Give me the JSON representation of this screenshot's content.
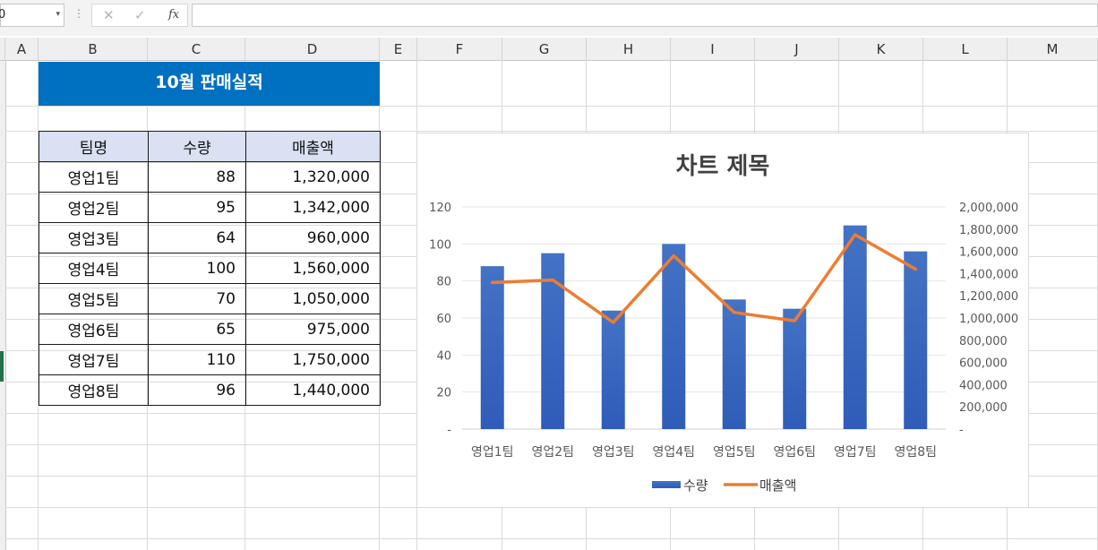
{
  "formula_bar": {
    "name_box_value": "0",
    "name_box_arrow": "▾",
    "dots": "⋮",
    "cancel_icon": "✕",
    "enter_icon": "✓",
    "fx_label": "fx",
    "formula_value": ""
  },
  "columns": [
    "A",
    "B",
    "C",
    "D",
    "E",
    "F",
    "G",
    "H",
    "I",
    "J",
    "K",
    "L",
    "M"
  ],
  "sheet": {
    "banner_title": "10월 판매실적",
    "table": {
      "headers": [
        "팀명",
        "수량",
        "매출액"
      ],
      "rows": [
        [
          "영업1팀",
          "88",
          "1,320,000"
        ],
        [
          "영업2팀",
          "95",
          "1,342,000"
        ],
        [
          "영업3팀",
          "64",
          "960,000"
        ],
        [
          "영업4팀",
          "100",
          "1,560,000"
        ],
        [
          "영업5팀",
          "70",
          "1,050,000"
        ],
        [
          "영업6팀",
          "65",
          "975,000"
        ],
        [
          "영업7팀",
          "110",
          "1,750,000"
        ],
        [
          "영업8팀",
          "96",
          "1,440,000"
        ]
      ]
    }
  },
  "colors": {
    "bar": "#4472c4",
    "bar_dark": "#2e5cb8",
    "line": "#ed7d31",
    "banner": "#0070c0",
    "header_fill": "#d9e1f2"
  },
  "chart_data": {
    "type": "bar",
    "title": "차트 제목",
    "categories": [
      "영업1팀",
      "영업2팀",
      "영업3팀",
      "영업4팀",
      "영업5팀",
      "영업6팀",
      "영업7팀",
      "영업8팀"
    ],
    "series": [
      {
        "name": "수량",
        "type": "bar",
        "axis": "left",
        "values": [
          88,
          95,
          64,
          100,
          70,
          65,
          110,
          96
        ]
      },
      {
        "name": "매출액",
        "type": "line",
        "axis": "right",
        "values": [
          1320000,
          1342000,
          960000,
          1560000,
          1050000,
          975000,
          1750000,
          1440000
        ]
      }
    ],
    "ylim": [
      0,
      120
    ],
    "y_ticks": [
      "-",
      "20",
      "40",
      "60",
      "80",
      "100",
      "120"
    ],
    "y2lim": [
      0,
      2000000
    ],
    "y2_ticks": [
      "-",
      "200,000",
      "400,000",
      "600,000",
      "800,000",
      "1,000,000",
      "1,200,000",
      "1,400,000",
      "1,600,000",
      "1,800,000",
      "2,000,000"
    ],
    "grid": true,
    "legend_position": "bottom"
  }
}
